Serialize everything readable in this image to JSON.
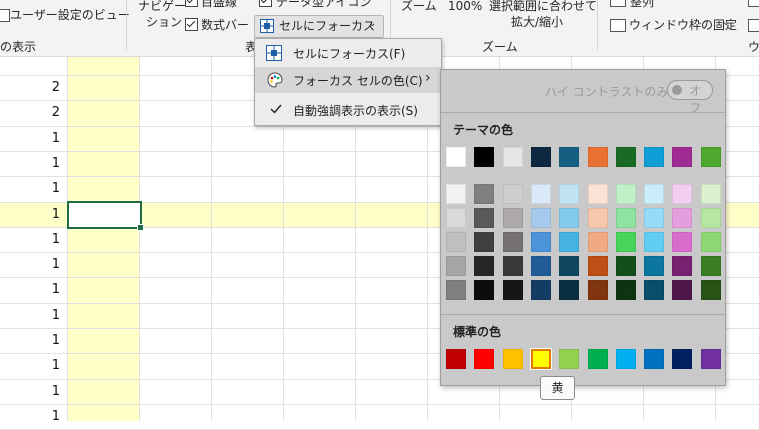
{
  "ribbon": {
    "user_view_label": "ユーザー設定のビュー",
    "show_group_label": "の表示",
    "navigation_label": "ナビゲー",
    "navigation_label2": "ション",
    "gridlines_label": "目盛線",
    "formula_bar_label": "数式バー",
    "data_icon_label": "データ型アイコン",
    "focus_cell_label": "セルにフォーカス",
    "show_group_label2": "表",
    "zoom_label": "ズーム",
    "zoom_100_label": "100%",
    "zoom_selection_label": "選択範囲に合わせて",
    "zoom_selection_label2": "拡大/縮小",
    "zoom_group_label": "ズーム",
    "arrange_label": "整列",
    "freeze_panes_label": "ウィンドウ枠の固定",
    "window_group_label": "ウ"
  },
  "grid": {
    "values": [
      "2",
      "2",
      "1",
      "1",
      "1",
      "1",
      "1",
      "1",
      "1",
      "1",
      "1",
      "1",
      "1",
      "1"
    ],
    "highlight_color": "#ffffc8",
    "active_cell_border": "#1f6e43"
  },
  "menu": {
    "items": [
      {
        "label": "セルにフォーカス(F)",
        "icon": "focus-cell-icon"
      },
      {
        "label": "フォーカス セルの色(C)",
        "icon": "palette-icon",
        "submenu": "›"
      },
      {
        "label": "自動強調表示の表示(S)",
        "icon": "check-icon",
        "checked": true
      }
    ]
  },
  "palette": {
    "high_contrast_label": "ハイ コントラストのみ(H)",
    "toggle_label": "オフ",
    "theme_label": "テーマの色",
    "standard_label": "標準の色",
    "theme_top": [
      "#ffffff",
      "#000000",
      "#e7e6e6",
      "#0e2841",
      "#156082",
      "#e97132",
      "#196b24",
      "#0f9ed5",
      "#a02b93",
      "#4ea72e"
    ],
    "theme_shades": [
      [
        "#f2f2f2",
        "#7f7f7f",
        "#d0cece",
        "#dae9f8",
        "#c1e4f5",
        "#fbe2d5",
        "#c1f0c8",
        "#caedfb",
        "#f2ceef",
        "#daf2d0"
      ],
      [
        "#d9d9d9",
        "#595959",
        "#aeaaaa",
        "#a6c9ec",
        "#83cbeb",
        "#f7c7ac",
        "#8ee3a0",
        "#95dcf8",
        "#e59edd",
        "#b5e6a2"
      ],
      [
        "#bfbfbf",
        "#3f3f3f",
        "#757171",
        "#4d93d9",
        "#44b3e1",
        "#f1a983",
        "#47d45a",
        "#60cbf3",
        "#d86dcd",
        "#8ed973"
      ],
      [
        "#a6a6a6",
        "#262626",
        "#3a3838",
        "#215c98",
        "#0f4761",
        "#c04f15",
        "#124f1a",
        "#0b76a0",
        "#782170",
        "#3b7d23"
      ],
      [
        "#808080",
        "#0d0d0d",
        "#171616",
        "#153d64",
        "#0a2f40",
        "#80350e",
        "#0d3512",
        "#074f6a",
        "#4f164b",
        "#275317"
      ]
    ],
    "standard": [
      "#c00000",
      "#ff0000",
      "#ffc000",
      "#ffff00",
      "#92d050",
      "#00b050",
      "#00b0f0",
      "#0070c0",
      "#002060",
      "#7030a0"
    ],
    "tooltip": "黄"
  }
}
